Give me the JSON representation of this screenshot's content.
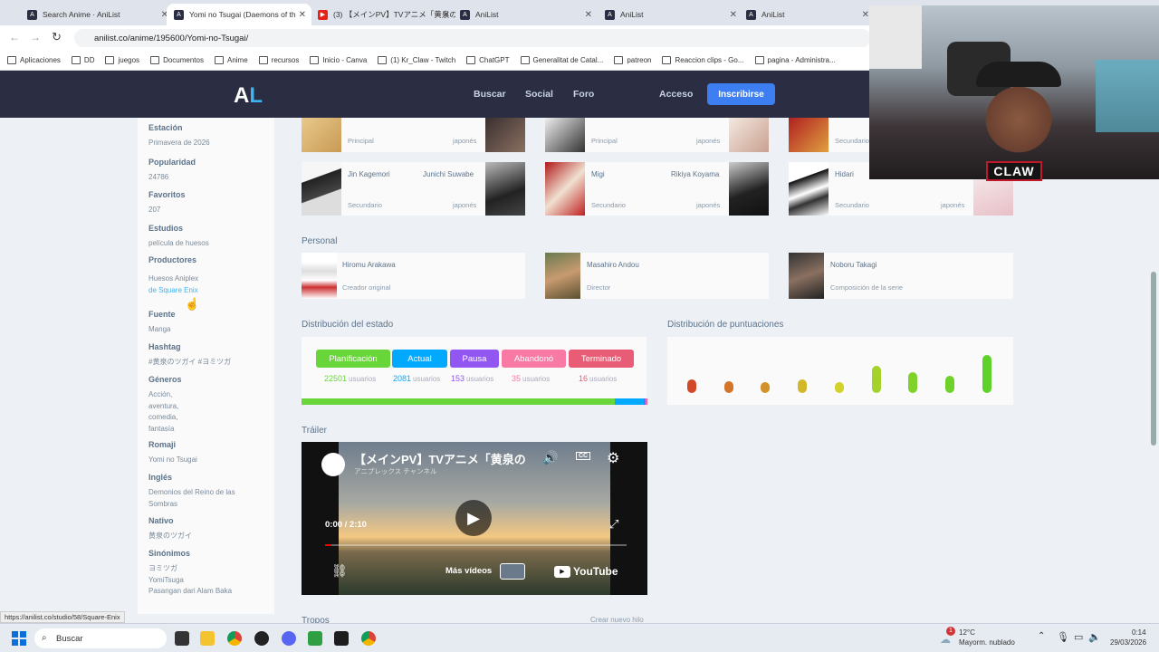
{
  "browser": {
    "tabs": [
      {
        "title": "Search Anime · AniList",
        "fav": "A",
        "color": "#2b2d42"
      },
      {
        "title": "Yomi no Tsugai (Daemons of th",
        "fav": "A",
        "color": "#2b2d42"
      },
      {
        "title": "(3) 【メインPV】TVアニメ「黄泉のツガ",
        "fav": "▶",
        "color": "#e62117"
      },
      {
        "title": "AniList",
        "fav": "A",
        "color": "#2b2d42"
      },
      {
        "title": "AniList",
        "fav": "A",
        "color": "#2b2d42"
      },
      {
        "title": "AniList",
        "fav": "A",
        "color": "#2b2d42"
      }
    ],
    "url": "anilist.co/anime/195600/Yomi-no-Tsugai/",
    "bookmarks": [
      "Aplicaciones",
      "DD",
      "juegos",
      "Documentos",
      "Anime",
      "recursos",
      "Inicio - Canva",
      "(1) Kr_Claw - Twitch",
      "ChatGPT",
      "Generalitat de Catal...",
      "patreon",
      "Reaccion clips - Go...",
      "pagina - Administra..."
    ]
  },
  "site": {
    "logo": "AL",
    "nav": [
      "Buscar",
      "Social",
      "Foro"
    ],
    "login": "Acceso",
    "signup": "Inscribirse"
  },
  "sidebar": [
    {
      "label": "Estación",
      "value": "Primavera de 2026"
    },
    {
      "label": "Popularidad",
      "value": "24786"
    },
    {
      "label": "Favoritos",
      "value": "207"
    },
    {
      "label": "Estudios",
      "value": "película de huesos"
    },
    {
      "label": "Productores",
      "value": "Huesos Aniplex",
      "value2": "de Square Enix"
    },
    {
      "label": "Fuente",
      "value": "Manga"
    },
    {
      "label": "Hashtag",
      "value": "#黄泉のツガイ #ヨミツガ"
    },
    {
      "label": "Géneros",
      "value": "Acción,",
      "value2": "aventura,",
      "value3": "comedia,",
      "value4": "fantasía"
    },
    {
      "label": "Romaji",
      "value": "Yomi no Tsugai"
    },
    {
      "label": "Inglés",
      "value": "Demonios del Reino de las",
      "value2": "Sombras"
    },
    {
      "label": "Nativo",
      "value": "黄泉のツガイ"
    },
    {
      "label": "Sinónimos",
      "value": "ヨミツガ",
      "value2": "YomiTsuga",
      "value3": "Pasangan dari Alam Baka"
    }
  ],
  "characters": {
    "top": [
      {
        "role": "Principal",
        "lang": "japonés"
      },
      {
        "role": "Principal",
        "lang": "japonés"
      },
      {
        "role": "Secundario",
        "lang": ""
      }
    ],
    "row": [
      {
        "name": "Jin Kagemori",
        "role": "Secundario",
        "va": "Junichi Suwabe",
        "lang": "japonés"
      },
      {
        "name": "Migi",
        "role": "Secundario",
        "va": "Rikiya Koyama",
        "lang": "japonés"
      },
      {
        "name": "Hidari",
        "role": "Secundario",
        "va": "",
        "lang": "japonés"
      }
    ]
  },
  "staff": {
    "title": "Personal",
    "items": [
      {
        "name": "Hiromu Arakawa",
        "role": "Creador original"
      },
      {
        "name": "Masahiro Andou",
        "role": "Director"
      },
      {
        "name": "Noboru Takagi",
        "role": "Composición de la serie"
      }
    ]
  },
  "status": {
    "title": "Distribución del estado",
    "items": [
      {
        "label": "Planificación",
        "count": "22501",
        "unit": "usuarios",
        "color": "#68d639"
      },
      {
        "label": "Actual",
        "count": "2081",
        "unit": "usuarios",
        "color": "#02a9ff"
      },
      {
        "label": "Pausa",
        "count": "153",
        "unit": "usuarios",
        "color": "#9256f3"
      },
      {
        "label": "Abandonó",
        "count": "35",
        "unit": "usuarios",
        "color": "#f779a4"
      },
      {
        "label": "Terminado",
        "count": "16",
        "unit": "usuarios",
        "color": "#e85d75"
      }
    ]
  },
  "scores": {
    "title": "Distribución de puntuaciones",
    "values": [
      0.35,
      0.3,
      0.28,
      0.35,
      0.28,
      0.72,
      0.55,
      0.45,
      1.0
    ],
    "colors": [
      "#d2492a",
      "#d2742a",
      "#d2922a",
      "#d2b72a",
      "#d2d22a",
      "#a4d22a",
      "#7ed22a",
      "#6fd22a",
      "#5ed22a"
    ]
  },
  "trailer": {
    "title": "Tráiler",
    "video_title": "【メインPV】TVアニメ「黄泉の",
    "channel": "アニプレックス チャンネル",
    "time": "0:00 / 2:10",
    "more": "Más vídeos",
    "yt": "YouTube",
    "progress": 0.02
  },
  "footer": {
    "tags": "Tropos",
    "new_thread": "Crear nuevo hilo"
  },
  "statusbar_url": "https://anilist.co/studio/58/Square-Enix",
  "taskbar": {
    "search": "Buscar",
    "weather_temp": "12°C",
    "weather_desc": "Mayorm. nublado",
    "time": "0:14",
    "date": "29/03/2026",
    "badge": "1"
  },
  "webcam": {
    "tag": "CLAW"
  }
}
